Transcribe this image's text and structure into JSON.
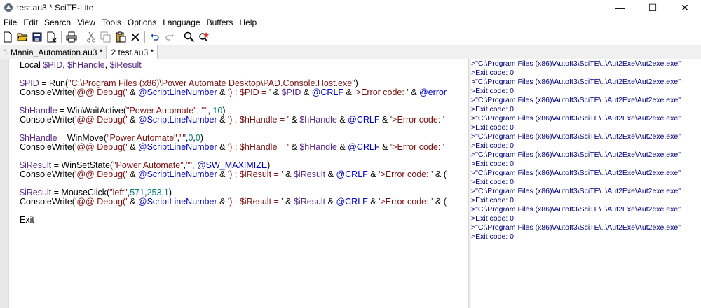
{
  "window": {
    "title": "test.au3 * SciTE-Lite",
    "controls": [
      {
        "name": "minimize-button",
        "glyph": "—"
      },
      {
        "name": "maximize-button",
        "glyph": "☐"
      },
      {
        "name": "close-button",
        "glyph": "✕"
      }
    ]
  },
  "menu": [
    "File",
    "Edit",
    "Search",
    "View",
    "Tools",
    "Options",
    "Language",
    "Buffers",
    "Help"
  ],
  "toolbar": {
    "buttons": [
      {
        "name": "new-file-icon",
        "glyph": "🗋"
      },
      {
        "name": "open-folder-icon",
        "glyph": "📂"
      },
      {
        "name": "save-icon",
        "glyph": "💾"
      },
      {
        "name": "close-file-icon",
        "glyph": "🗎"
      },
      {
        "name": "print-icon",
        "glyph": "🖶"
      },
      {
        "name": "cut-icon",
        "glyph": "✂"
      },
      {
        "name": "copy-icon",
        "glyph": "⧉"
      },
      {
        "name": "paste-icon",
        "glyph": "📋"
      },
      {
        "name": "delete-icon",
        "glyph": "✕"
      },
      {
        "name": "undo-icon",
        "glyph": "↶"
      },
      {
        "name": "redo-icon",
        "glyph": "↷"
      },
      {
        "name": "find-icon",
        "glyph": "🔍"
      },
      {
        "name": "replace-icon",
        "glyph": "⚲"
      }
    ]
  },
  "tabs": [
    {
      "label": "1 Mania_Automation.au3 *",
      "active": false
    },
    {
      "label": "2 test.au3 *",
      "active": true
    }
  ],
  "editor": {
    "lines": [
      "Local $PID, $hHandle, $iResult",
      "",
      "$PID = Run(\"C:\\Program Files (x86)\\Power Automate Desktop\\PAD.Console.Host.exe\")",
      "ConsoleWrite('@@ Debug(' & @ScriptLineNumber & ') : $PID = ' & $PID & @CRLF & '>Error code: ' & @error",
      "",
      "$hHandle = WinWaitActive(\"Power Automate\", \"\", 10)",
      "ConsoleWrite('@@ Debug(' & @ScriptLineNumber & ') : $hHandle = ' & $hHandle & @CRLF & '>Error code: '",
      "",
      "$hHandle = WinMove(\"Power Automate\",\"\",0,0)",
      "ConsoleWrite('@@ Debug(' & @ScriptLineNumber & ') : $hHandle = ' & $hHandle & @CRLF & '>Error code: '",
      "",
      "$iResult = WinSetState(\"Power Automate\",\"\", @SW_MAXIMIZE)",
      "ConsoleWrite('@@ Debug(' & @ScriptLineNumber & ') : $iResult = ' & $iResult & @CRLF & '>Error code: ' & (",
      "",
      "$iResult = MouseClick(\"left\",571,253,1)",
      "ConsoleWrite('@@ Debug(' & @ScriptLineNumber & ') : $iResult = ' & $iResult & @CRLF & '>Error code: ' & (",
      "",
      "Exit"
    ]
  },
  "output": {
    "lines": [
      ">\"C:\\Program Files (x86)\\AutoIt3\\SciTE\\..\\Aut2Exe\\Aut2exe.exe\"",
      ">Exit code: 0",
      ">\"C:\\Program Files (x86)\\AutoIt3\\SciTE\\..\\Aut2Exe\\Aut2exe.exe\"",
      ">Exit code: 0",
      ">\"C:\\Program Files (x86)\\AutoIt3\\SciTE\\..\\Aut2Exe\\Aut2exe.exe\"",
      ">Exit code: 0",
      ">\"C:\\Program Files (x86)\\AutoIt3\\SciTE\\..\\Aut2Exe\\Aut2exe.exe\"",
      ">Exit code: 0",
      ">\"C:\\Program Files (x86)\\AutoIt3\\SciTE\\..\\Aut2Exe\\Aut2exe.exe\"",
      ">Exit code: 0",
      ">\"C:\\Program Files (x86)\\AutoIt3\\SciTE\\..\\Aut2Exe\\Aut2exe.exe\"",
      ">Exit code: 0",
      ">\"C:\\Program Files (x86)\\AutoIt3\\SciTE\\..\\Aut2Exe\\Aut2exe.exe\"",
      ">Exit code: 0",
      ">\"C:\\Program Files (x86)\\AutoIt3\\SciTE\\..\\Aut2Exe\\Aut2exe.exe\"",
      ">Exit code: 0",
      ">\"C:\\Program Files (x86)\\AutoIt3\\SciTE\\..\\Aut2Exe\\Aut2exe.exe\"",
      ">Exit code: 0",
      ">\"C:\\Program Files (x86)\\AutoIt3\\SciTE\\..\\Aut2Exe\\Aut2exe.exe\"",
      ">Exit code: 0"
    ]
  }
}
